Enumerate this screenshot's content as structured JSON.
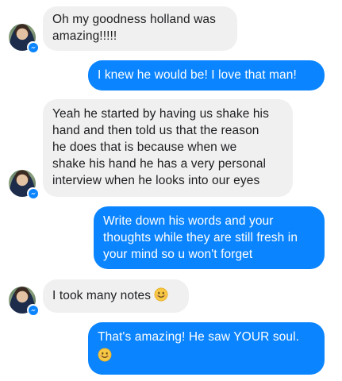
{
  "messages": [
    {
      "direction": "in",
      "text": "Oh my goodness holland was\namazing!!!!!"
    },
    {
      "direction": "out",
      "text": "I knew he would be!  I love that man!"
    },
    {
      "direction": "in",
      "text": "Yeah he started by having us shake his\nhand and then told us that the reason\nhe does that is because when we\nshake his hand he has a very personal\ninterview when he looks into our eyes"
    },
    {
      "direction": "out",
      "text": "Write down his words and your\nthoughts while they are still fresh in\nyour mind so u won't forget"
    },
    {
      "direction": "in",
      "text": "I took many notes"
    },
    {
      "direction": "out",
      "text": "That's amazing!  He saw YOUR soul."
    }
  ],
  "icons": {
    "avatar": "contact-avatar",
    "badge": "messenger-icon",
    "emoji": "smiling-face-emoji"
  },
  "colors": {
    "incoming_bubble": "#f1f0f0",
    "outgoing_bubble": "#0a84ff",
    "incoming_text": "#1c1e21",
    "outgoing_text": "#ffffff"
  }
}
